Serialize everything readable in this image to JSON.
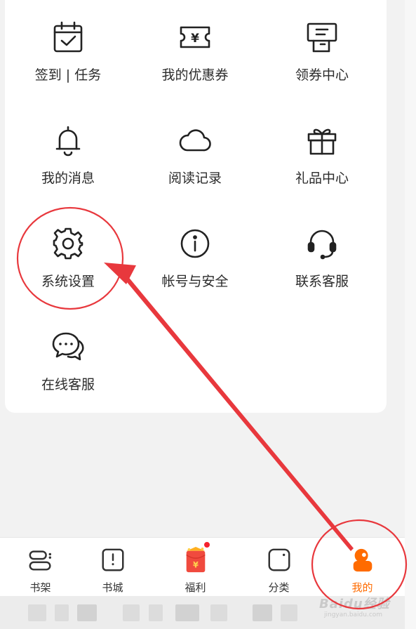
{
  "menu": {
    "items": [
      {
        "label": "签到 | 任务",
        "icon": "calendar-check-icon"
      },
      {
        "label": "我的优惠券",
        "icon": "coupon-icon"
      },
      {
        "label": "领券中心",
        "icon": "coupon-center-icon"
      },
      {
        "label": "我的消息",
        "icon": "bell-icon"
      },
      {
        "label": "阅读记录",
        "icon": "cloud-icon"
      },
      {
        "label": "礼品中心",
        "icon": "gift-icon"
      },
      {
        "label": "系统设置",
        "icon": "gear-icon"
      },
      {
        "label": "帐号与安全",
        "icon": "info-icon"
      },
      {
        "label": "联系客服",
        "icon": "headset-icon"
      },
      {
        "label": "在线客服",
        "icon": "chat-icon"
      }
    ]
  },
  "tabbar": {
    "tabs": [
      {
        "label": "书架",
        "icon": "bookshelf-icon",
        "active": false
      },
      {
        "label": "书城",
        "icon": "bookstore-icon",
        "active": false
      },
      {
        "label": "福利",
        "icon": "red-envelope-icon",
        "active": false,
        "badge": true
      },
      {
        "label": "分类",
        "icon": "category-icon",
        "active": false
      },
      {
        "label": "我的",
        "icon": "profile-icon",
        "active": true
      }
    ]
  },
  "coupon_symbol": "¥",
  "envelope_symbol": "¥",
  "watermark": {
    "text": "Baidu经验",
    "sub": "jingyan.baidu.com"
  },
  "colors": {
    "accent": "#ff6b00",
    "annotation": "#e8383d",
    "badge": "#f5222d",
    "envelope": "#f04a3e"
  }
}
